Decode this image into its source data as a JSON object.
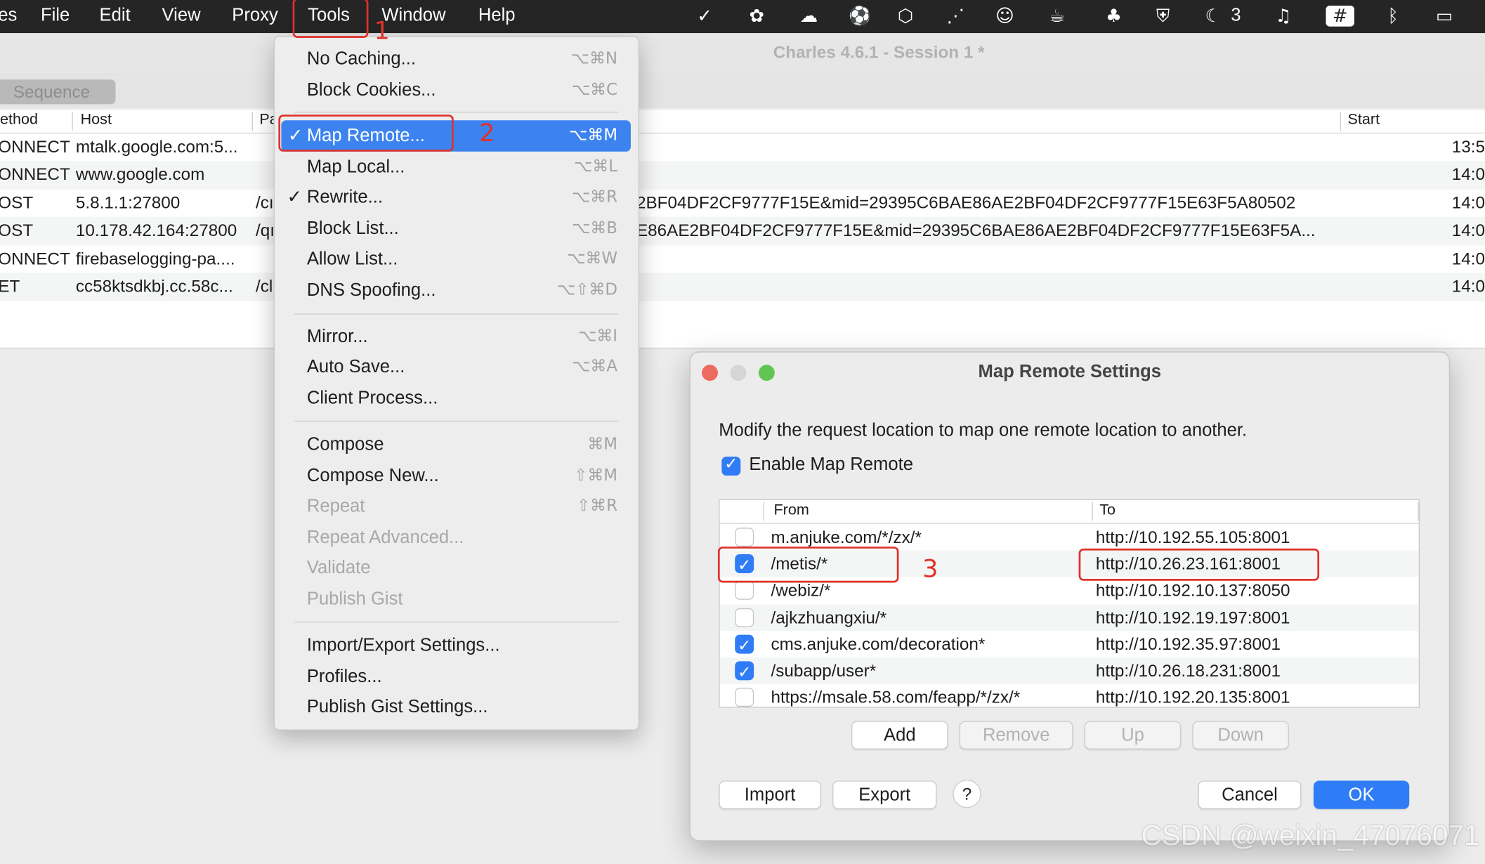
{
  "menubar": {
    "items": [
      "es",
      "File",
      "Edit",
      "View",
      "Proxy",
      "Tools",
      "Window",
      "Help"
    ],
    "status_icons": [
      "vpn-icon",
      "elephant-icon",
      "wechat-icon",
      "soccer-icon",
      "hexagon-icon",
      "wifi-signal-icon",
      "cat-icon",
      "cup-icon",
      "clover-icon",
      "shield-icon",
      "moon-badge-icon",
      "headphones-icon",
      "hash-icon",
      "bluetooth-icon",
      "battery-icon"
    ],
    "status_badge": "3"
  },
  "window": {
    "title": "Charles 4.6.1 - Session 1 *"
  },
  "sequence": {
    "tab_label": "Sequence",
    "columns": [
      "ethod",
      "Host",
      "Pa",
      "Start"
    ],
    "rows": [
      {
        "method": "ONNECT",
        "host": "mtalk.google.com:5...",
        "path": "",
        "query": "",
        "start": "13:5"
      },
      {
        "method": "ONNECT",
        "host": "www.google.com",
        "path": "",
        "query": "",
        "start": "14:0"
      },
      {
        "method": "OST",
        "host": "5.8.1.1:27800",
        "path": "/cı",
        "query": "2BF04DF2CF9777F15E&mid=29395C6BAE86AE2BF04DF2CF9777F15E63F5A80502",
        "start": "14:0"
      },
      {
        "method": "OST",
        "host": "10.178.42.164:27800",
        "path": "/qı",
        "query": "E86AE2BF04DF2CF9777F15E&mid=29395C6BAE86AE2BF04DF2CF9777F15E63F5A...",
        "start": "14:0"
      },
      {
        "method": "ONNECT",
        "host": "firebaselogging-pa....",
        "path": "",
        "query": "",
        "start": "14:0"
      },
      {
        "method": "ET",
        "host": "cc58ktsdkbj.cc.58c...",
        "path": "/cl",
        "query": "",
        "start": "14:0"
      }
    ]
  },
  "tools_menu": {
    "items": [
      {
        "label": "No Caching...",
        "shortcut": "⌥⌘N",
        "checked": false,
        "disabled": false
      },
      {
        "label": "Block Cookies...",
        "shortcut": "⌥⌘C",
        "checked": false,
        "disabled": false
      },
      {
        "label": "Map Remote...",
        "shortcut": "⌥⌘M",
        "checked": true,
        "disabled": false,
        "selected": true
      },
      {
        "label": "Map Local...",
        "shortcut": "⌥⌘L",
        "checked": false,
        "disabled": false
      },
      {
        "label": "Rewrite...",
        "shortcut": "⌥⌘R",
        "checked": true,
        "disabled": false
      },
      {
        "label": "Block List...",
        "shortcut": "⌥⌘B",
        "checked": false,
        "disabled": false
      },
      {
        "label": "Allow List...",
        "shortcut": "⌥⌘W",
        "checked": false,
        "disabled": false
      },
      {
        "label": "DNS Spoofing...",
        "shortcut": "⌥⇧⌘D",
        "checked": false,
        "disabled": false
      },
      {
        "label": "Mirror...",
        "shortcut": "⌥⌘I",
        "checked": false,
        "disabled": false
      },
      {
        "label": "Auto Save...",
        "shortcut": "⌥⌘A",
        "checked": false,
        "disabled": false
      },
      {
        "label": "Client Process...",
        "shortcut": "",
        "checked": false,
        "disabled": false
      },
      {
        "label": "Compose",
        "shortcut": "⌘M",
        "checked": false,
        "disabled": false
      },
      {
        "label": "Compose New...",
        "shortcut": "⇧⌘M",
        "checked": false,
        "disabled": false
      },
      {
        "label": "Repeat",
        "shortcut": "⇧⌘R",
        "checked": false,
        "disabled": true
      },
      {
        "label": "Repeat Advanced...",
        "shortcut": "",
        "checked": false,
        "disabled": true
      },
      {
        "label": "Validate",
        "shortcut": "",
        "checked": false,
        "disabled": true
      },
      {
        "label": "Publish Gist",
        "shortcut": "",
        "checked": false,
        "disabled": true
      },
      {
        "label": "Import/Export Settings...",
        "shortcut": "",
        "checked": false,
        "disabled": false
      },
      {
        "label": "Profiles...",
        "shortcut": "",
        "checked": false,
        "disabled": false
      },
      {
        "label": "Publish Gist Settings...",
        "shortcut": "",
        "checked": false,
        "disabled": false
      }
    ]
  },
  "dialog": {
    "title": "Map Remote Settings",
    "description": "Modify the request location to map one remote location to another.",
    "enable_label": "Enable Map Remote",
    "enable_checked": true,
    "columns": {
      "from": "From",
      "to": "To"
    },
    "mappings": [
      {
        "enabled": false,
        "from": "m.anjuke.com/*/zx/*",
        "to": "http://10.192.55.105:8001"
      },
      {
        "enabled": true,
        "from": "/metis/*",
        "to": "http://10.26.23.161:8001"
      },
      {
        "enabled": false,
        "from": "/webiz/*",
        "to": "http://10.192.10.137:8050"
      },
      {
        "enabled": false,
        "from": "/ajkzhuangxiu/*",
        "to": "http://10.192.19.197:8001"
      },
      {
        "enabled": true,
        "from": "cms.anjuke.com/decoration*",
        "to": "http://10.192.35.97:8001"
      },
      {
        "enabled": true,
        "from": "/subapp/user*",
        "to": "http://10.26.18.231:8001"
      },
      {
        "enabled": false,
        "from": "https://msale.58.com/feapp/*/zx/*",
        "to": "http://10.192.20.135:8001"
      }
    ],
    "buttons": {
      "add": "Add",
      "remove": "Remove",
      "up": "Up",
      "down": "Down",
      "import": "Import",
      "export": "Export",
      "help": "?",
      "cancel": "Cancel",
      "ok": "OK"
    },
    "traffic_lights": {
      "close": "#ed6a5e",
      "minimize": "#d6d6d6",
      "zoom": "#61c554"
    }
  },
  "annotations": {
    "step1": "1",
    "step2": "2",
    "step3": "3",
    "color": "#e0312a"
  },
  "watermark": "CSDN @weixin_47076071",
  "colors": {
    "accent": "#3c83f0",
    "checkbox": "#2f7cf6",
    "menubar": "#252525"
  }
}
